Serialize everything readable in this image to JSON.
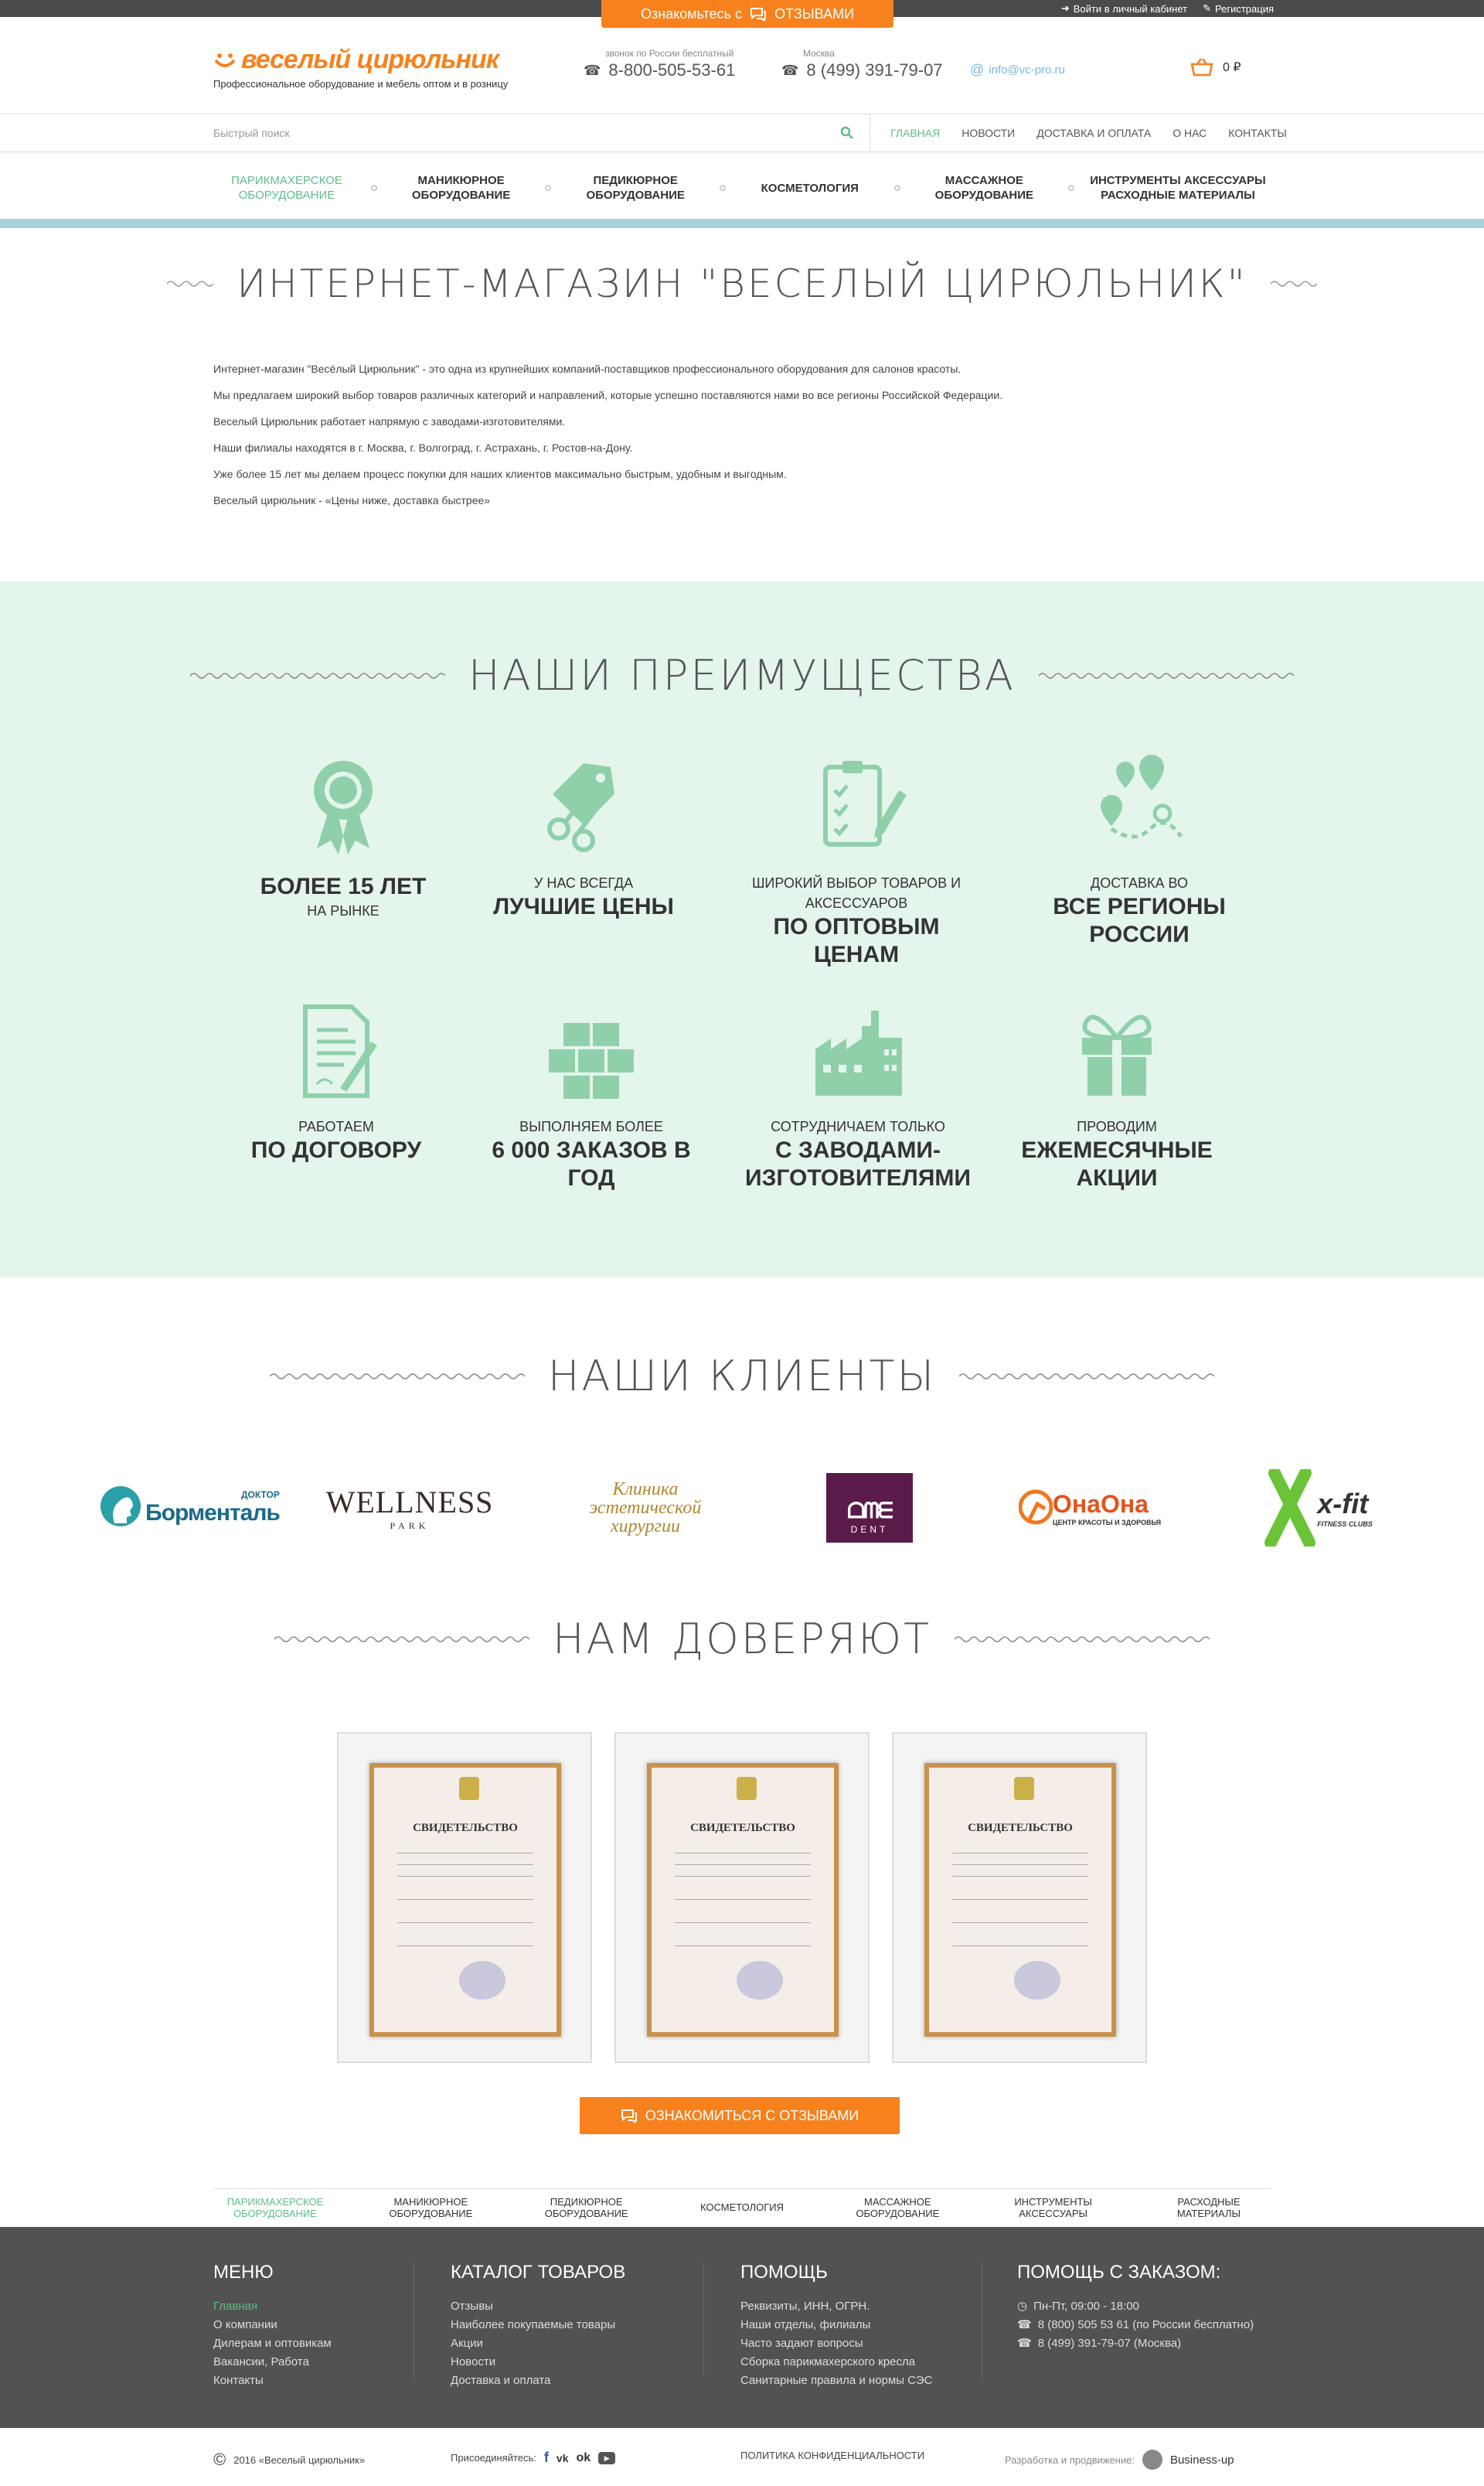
{
  "topbar": {
    "reviews_prefix": "Ознакомьтесь с",
    "reviews_label": "ОТЗЫВАМИ",
    "login": "Войти в личный кабинет",
    "register": "Регистрация"
  },
  "header": {
    "logo_name": "веселый цирюльник",
    "tagline": "Профессиональное оборудование и мебель оптом и в розницу",
    "phone1_caption": "звонок по России бесплатный",
    "phone1": "8-800-505-53-61",
    "phone2_caption": "Москва",
    "phone2": "8 (499) 391-79-07",
    "email": "info@vc-pro.ru",
    "cart_total": "0 ₽"
  },
  "search": {
    "placeholder": "Быстрый поиск"
  },
  "topnav": [
    "Главная",
    "Новости",
    "Доставка и оплата",
    "О нас",
    "Контакты"
  ],
  "categories": [
    {
      "l1": "Парикмахерское",
      "l2": "оборудование"
    },
    {
      "l1": "Маникюрное",
      "l2": "оборудование"
    },
    {
      "l1": "Педикюрное",
      "l2": "оборудование"
    },
    {
      "l1": "Косметология",
      "l2": ""
    },
    {
      "l1": "Массажное",
      "l2": "оборудование"
    },
    {
      "l1": "Инструменты аксессуары",
      "l2": "расходные материалы"
    }
  ],
  "intro": {
    "title": "ИНТЕРНЕТ-МАГАЗИН \"ВЕСЕЛЫЙ ЦИРЮЛЬНИК\"",
    "paragraphs": [
      "Интернет-магазин \"Весёлый Цирюльник\" - это одна из крупнейших компаний-поставщиков профессионального оборудования для салонов красоты.",
      "Мы предлагаем широкий выбор товаров различных категорий и направлений, которые успешно поставляются нами во все регионы Российской Федерации.",
      "Веселый Цирюльник работает напрямую с заводами-изготовителями.",
      "Наши филиалы находятся в г. Москва, г. Волгоград, г. Астрахань, г. Ростов-на-Дону.",
      "Уже более 15 лет мы делаем процесс покупки для наших клиентов максимально быстрым, удобным и выгодным.",
      "Веселый цирюльник - «Цены ниже, доставка быстрее»"
    ]
  },
  "advantages": {
    "title": "НАШИ ПРЕИМУЩЕСТВА",
    "items": [
      {
        "icon": "award-icon",
        "sm_top": "",
        "lg": "БОЛЕЕ 15 ЛЕТ",
        "sm_bottom": "НА РЫНКЕ"
      },
      {
        "icon": "scissors-tag-icon",
        "sm_top": "У НАС ВСЕГДА",
        "lg": "ЛУЧШИЕ ЦЕНЫ",
        "sm_bottom": ""
      },
      {
        "icon": "checklist-icon",
        "sm_top": "ШИРОКИЙ ВЫБОР ТОВАРОВ И АКСЕССУАРОВ",
        "lg": "ПО ОПТОВЫМ ЦЕНАМ",
        "sm_bottom": ""
      },
      {
        "icon": "delivery-map-icon",
        "sm_top": "ДОСТАВКА ВО",
        "lg": "ВСЕ РЕГИОНЫ РОССИИ",
        "sm_bottom": ""
      },
      {
        "icon": "contract-icon",
        "sm_top": "РАБОТАЕМ",
        "lg": "ПО ДОГОВОРУ",
        "sm_bottom": ""
      },
      {
        "icon": "boxes-icon",
        "sm_top": "ВЫПОЛНЯЕМ БОЛЕЕ",
        "lg": "6 000 ЗАКАЗОВ В ГОД",
        "sm_bottom": ""
      },
      {
        "icon": "factory-icon",
        "sm_top": "СОТРУДНИЧАЕМ ТОЛЬКО",
        "lg": "С ЗАВОДАМИ-ИЗГОТОВИТЕЛЯМИ",
        "sm_bottom": ""
      },
      {
        "icon": "gift-icon",
        "sm_top": "ПРОВОДИМ",
        "lg": "ЕЖЕМЕСЯЧНЫЕ АКЦИИ",
        "sm_bottom": ""
      }
    ]
  },
  "clients": {
    "title": "НАШИ КЛИЕНТЫ",
    "logos": [
      {
        "small": "ДОКТОР",
        "big": "Борменталь"
      },
      {
        "big": "WELLNESS",
        "small": "PARK"
      },
      {
        "big": "Клиника эстетической хирургии"
      },
      {
        "big": "DENT"
      },
      {
        "big": "ОнаОна",
        "small": "ЦЕНТР КРАСОТЫ И ЗДОРОВЬЯ"
      },
      {
        "big": "x-fit",
        "small": "FITNESS CLUBS"
      }
    ]
  },
  "trust": {
    "title": "НАМ ДОВЕРЯЮТ",
    "cert_heading": "СВИДЕТЕЛЬСТВО",
    "button": "Ознакомиться с отзывами"
  },
  "catnav_bottom": [
    {
      "l1": "Парикмахерское",
      "l2": "оборудование"
    },
    {
      "l1": "Маникюрное",
      "l2": "оборудование"
    },
    {
      "l1": "Педикюрное",
      "l2": "оборудование"
    },
    {
      "l1": "Косметология",
      "l2": ""
    },
    {
      "l1": "Массажное",
      "l2": "оборудование"
    },
    {
      "l1": "Инструменты",
      "l2": "аксессуары"
    },
    {
      "l1": "Расходные",
      "l2": "материалы"
    }
  ],
  "footer": {
    "menu_title": "МЕНЮ",
    "menu": [
      "Главная",
      "О компании",
      "Дилерам и оптовикам",
      "Вакансии, Работа",
      "Контакты"
    ],
    "catalog_title": "КАТАЛОГ ТОВАРОВ",
    "catalog": [
      "Отзывы",
      "Наиболее покупаемые товары",
      "Акции",
      "Новости",
      "Доставка и оплата"
    ],
    "help_title": "ПОМОЩЬ",
    "help": [
      "Реквизиты, ИНН, ОГРН.",
      "Наши отделы, филиалы",
      "Часто задают вопросы",
      "Сборка парикмахерского кресла",
      "Санитарные правила и нормы СЭС"
    ],
    "order_title": "ПОМОЩЬ С ЗАКАЗОМ:",
    "order": [
      "Пн-Пт, 09:00 - 18:00",
      "8 (800) 505 53 61 (по России бесплатно)",
      "8 (499) 391-79-07 (Москва)"
    ],
    "copyright": "2016 «Веселый цирюльник»",
    "join": "Присоединяйтесь:",
    "privacy": "ПОЛИТИКА КОНФИДЕНЦИАЛЬНОСТИ",
    "dev_label": "Разработка и продвижение:",
    "dev_name": "Business-up"
  },
  "colors": {
    "accent": "#f7811d",
    "green": "#5ebd8a",
    "adv_bg": "#e4f5eb",
    "icon": "#8fd0ab",
    "footer": "#525252"
  }
}
